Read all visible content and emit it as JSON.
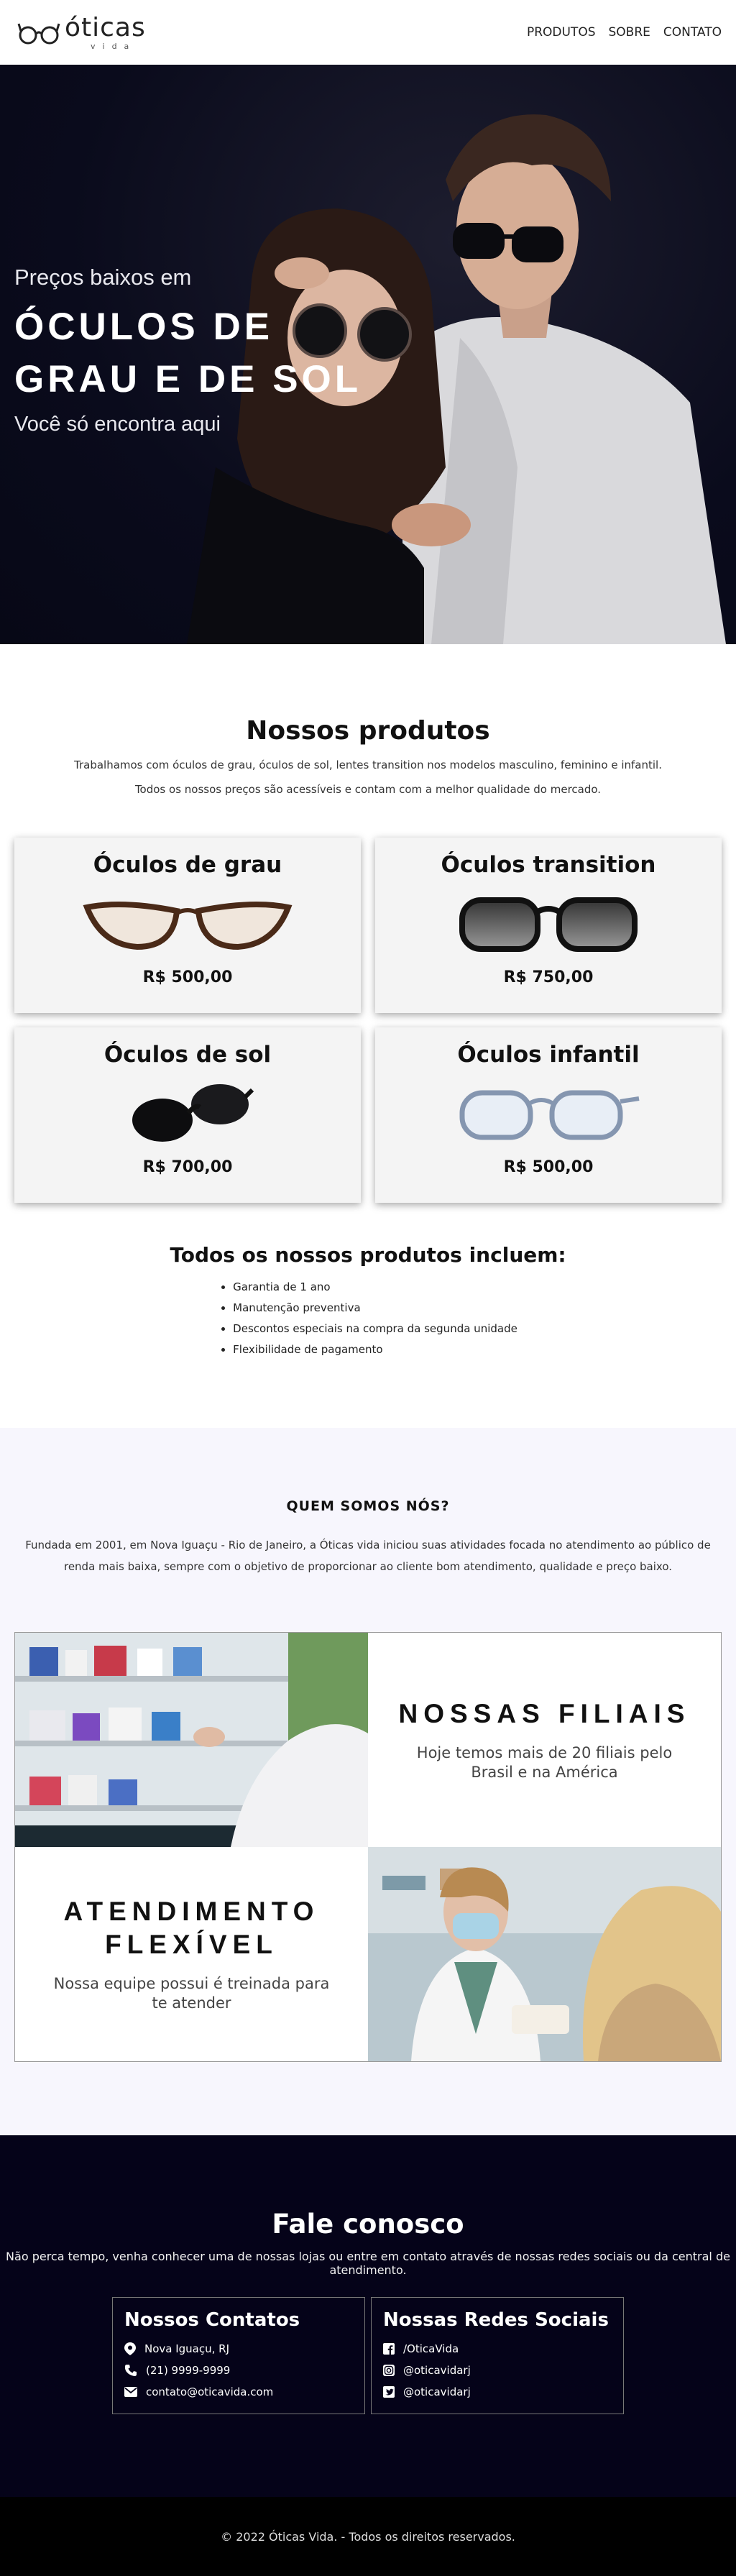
{
  "header": {
    "logo": {
      "main": "óticas",
      "sub": "vida"
    },
    "nav": [
      {
        "label": "PRODUTOS"
      },
      {
        "label": "SOBRE"
      },
      {
        "label": "CONTATO"
      }
    ]
  },
  "hero": {
    "pretitle": "Preços baixos em",
    "title": "ÓCULOS DE GRAU E DE SOL",
    "subtitle": "Você só encontra aqui"
  },
  "products": {
    "title": "Nossos produtos",
    "intro_1": "Trabalhamos com óculos de grau, óculos de sol, lentes transition nos modelos masculino, feminino e infantil.",
    "intro_2": "Todos os nossos preços são acessíveis e contam com a melhor qualidade do mercado.",
    "items": [
      {
        "name": "Óculos de grau",
        "price": "R$ 500,00",
        "icon": "cat-eye-glasses-icon"
      },
      {
        "name": "Óculos transition",
        "price": "R$ 750,00",
        "icon": "transition-glasses-icon"
      },
      {
        "name": "Óculos de sol",
        "price": "R$ 700,00",
        "icon": "sunglasses-icon"
      },
      {
        "name": "Óculos infantil",
        "price": "R$ 500,00",
        "icon": "kids-glasses-icon"
      }
    ],
    "includes_title": "Todos os nossos produtos incluem:",
    "includes": [
      "Garantia de 1 ano",
      "Manutenção preventiva",
      "Descontos especiais na compra da segunda unidade",
      "Flexibilidade de pagamento"
    ]
  },
  "about": {
    "title": "QUEM SOMOS NÓS?",
    "text": "Fundada em 2001, em Nova Iguaçu - Rio de Janeiro, a Óticas vida iniciou suas atividades focada no atendimento ao público de renda mais baixa, sempre com o objetivo de proporcionar ao cliente bom atendimento, qualidade e preço baixo.",
    "features": [
      {
        "title": "NOSSAS FILIAIS",
        "text": "Hoje temos mais de 20 filiais pelo Brasil e na América"
      },
      {
        "title": "ATENDIMENTO FLEXÍVEL",
        "text": "Nossa equipe possui é treinada para te atender"
      }
    ]
  },
  "contact": {
    "title": "Fale conosco",
    "lead": "Não perca tempo, venha conhecer uma de nossas lojas ou entre em contato através de nossas redes sociais ou da central de atendimento.",
    "contacts_title": "Nossos Contatos",
    "contacts": [
      {
        "icon": "map-pin-icon",
        "text": "Nova Iguaçu, RJ"
      },
      {
        "icon": "phone-icon",
        "text": "(21) 9999-9999"
      },
      {
        "icon": "envelope-icon",
        "text": "contato@oticavida.com"
      }
    ],
    "social_title": "Nossas Redes Sociais",
    "social": [
      {
        "icon": "facebook-icon",
        "text": "/OticaVida"
      },
      {
        "icon": "instagram-icon",
        "text": "@oticavidarj"
      },
      {
        "icon": "twitter-icon",
        "text": "@oticavidarj"
      }
    ]
  },
  "footer": {
    "text": "© 2022 Óticas Vida. - Todos os direitos reservados."
  },
  "colors": {
    "dark_navy": "#050319",
    "about_bg": "#f7f6fd",
    "card_bg": "#f4f4f4"
  }
}
